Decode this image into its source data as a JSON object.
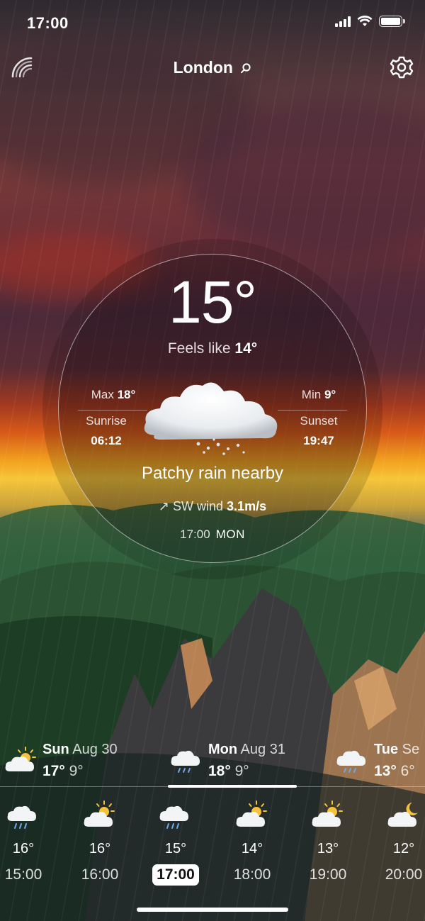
{
  "status_bar": {
    "time": "17:00"
  },
  "nav": {
    "city": "London"
  },
  "current": {
    "temperature": "15°",
    "feels_prefix": "Feels like",
    "feels_value": "14°",
    "max_label": "Max",
    "max_value": "18°",
    "min_label": "Min",
    "min_value": "9°",
    "sunrise_label": "Sunrise",
    "sunrise_value": "06:12",
    "sunset_label": "Sunset",
    "sunset_value": "19:47",
    "condition": "Patchy rain nearby",
    "wind_arrow": "↗",
    "wind_prefix": "SW wind",
    "wind_value": "3.1m/s",
    "time": "17:00",
    "day": "MON"
  },
  "daily": [
    {
      "day": "Sun",
      "date": "Aug 30",
      "max": "17°",
      "min": "9°",
      "icon": "sun-cloud-icon"
    },
    {
      "day": "Mon",
      "date": "Aug 31",
      "max": "18°",
      "min": "9°",
      "icon": "rain-cloud-icon"
    },
    {
      "day": "Tue",
      "date": "Se",
      "max": "13°",
      "min": "6°",
      "icon": "rain-cloud-icon"
    }
  ],
  "hourly": [
    {
      "temp": "16°",
      "hour": "15:00",
      "icon": "rain-cloud-icon"
    },
    {
      "temp": "16°",
      "hour": "16:00",
      "icon": "sun-cloud-icon"
    },
    {
      "temp": "15°",
      "hour": "17:00",
      "icon": "rain-cloud-icon",
      "active": true
    },
    {
      "temp": "14°",
      "hour": "18:00",
      "icon": "sun-cloud-icon"
    },
    {
      "temp": "13°",
      "hour": "19:00",
      "icon": "sun-cloud-icon"
    },
    {
      "temp": "12°",
      "hour": "20:00",
      "icon": "moon-cloud-icon"
    }
  ],
  "colors": {
    "sun": "#f5c23b",
    "rain": "#6fa8e8",
    "text": "#ffffff"
  }
}
